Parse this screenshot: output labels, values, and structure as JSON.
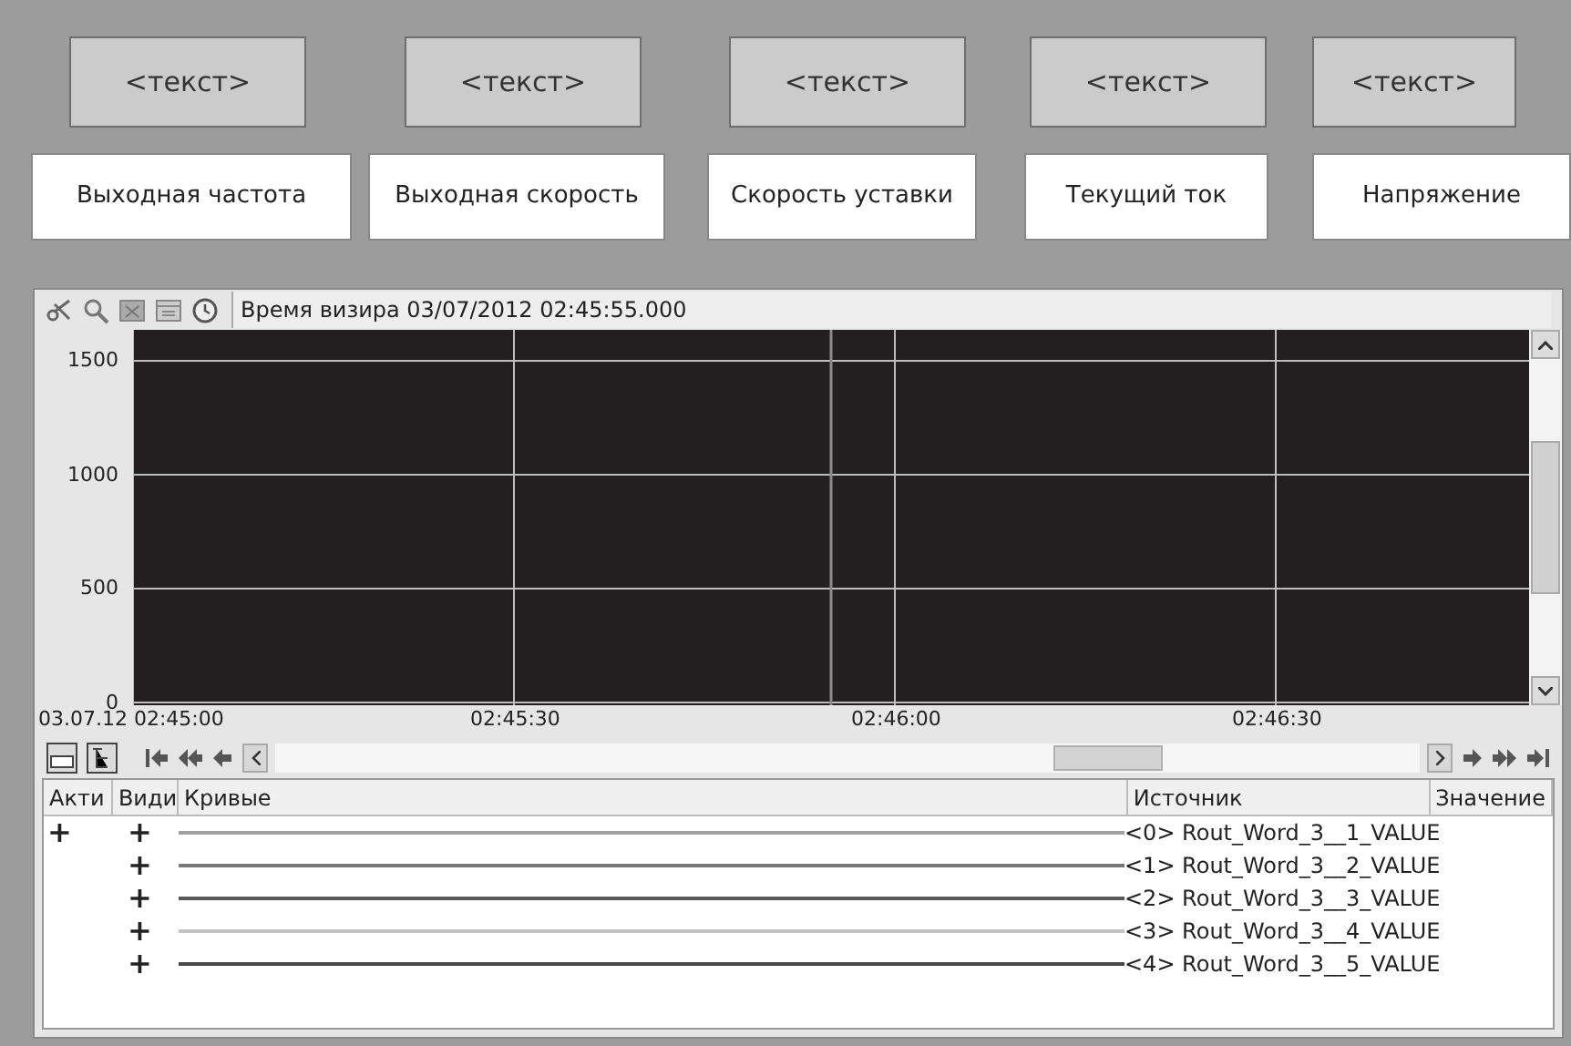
{
  "display_fields": [
    {
      "text": "<текст>"
    },
    {
      "text": "<текст>"
    },
    {
      "text": "<текст>"
    },
    {
      "text": "<текст>"
    },
    {
      "text": "<текст>"
    }
  ],
  "labels": [
    "Выходная частота",
    "Выходная скорость",
    "Скорость уставки",
    "Текущий ток",
    "Напряжение"
  ],
  "trend": {
    "cursor_time": "Время визира 03/07/2012 02:45:55.000",
    "plot": {
      "y_labels": [
        "1500",
        "1000",
        "500",
        "0"
      ],
      "x_labels": [
        "03.07.12 02:45:00",
        "02:45:30",
        "02:46:00",
        "02:46:30"
      ]
    },
    "table": {
      "columns": [
        "Акти",
        "Види",
        "Кривые",
        "Источник",
        "Значение"
      ],
      "rows": [
        {
          "active": true,
          "visible": true,
          "color": "#a0a0a0",
          "source": "<0> Rout_Word_3__1_VALUE"
        },
        {
          "active": false,
          "visible": true,
          "color": "#787878",
          "source": "<1> Rout_Word_3__2_VALUE"
        },
        {
          "active": false,
          "visible": true,
          "color": "#585858",
          "source": "<2> Rout_Word_3__3_VALUE"
        },
        {
          "active": false,
          "visible": true,
          "color": "#c4c4c4",
          "source": "<3> Rout_Word_3__4_VALUE"
        },
        {
          "active": false,
          "visible": true,
          "color": "#484848",
          "source": "<4> Rout_Word_3__5_VALUE"
        }
      ]
    },
    "plus_mark": "+"
  }
}
